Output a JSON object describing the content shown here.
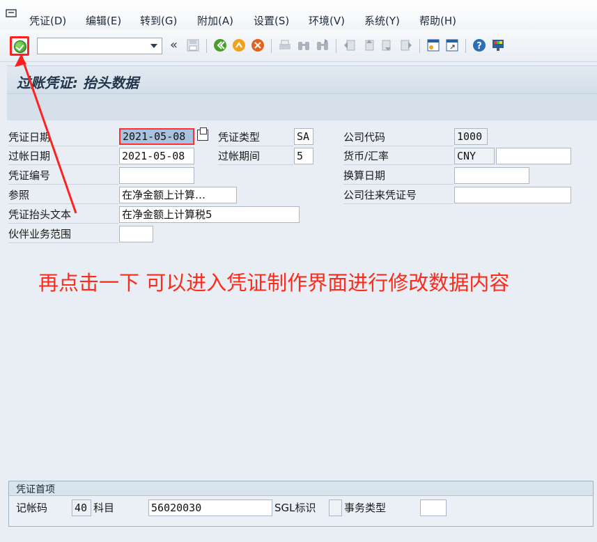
{
  "menu": {
    "items": [
      "凭证(D)",
      "编辑(E)",
      "转到(G)",
      "附加(A)",
      "设置(S)",
      "环境(V)",
      "系统(Y)",
      "帮助(H)"
    ]
  },
  "toolbar": {
    "command_value": "",
    "back_glyph": "«",
    "icons": [
      "enter-icon",
      "save-icon",
      "back-icon",
      "exit-icon",
      "cancel-icon",
      "print-icon",
      "find-icon",
      "find-next-icon",
      "first-page-icon",
      "prev-page-icon",
      "next-page-icon",
      "last-page-icon",
      "new-session-icon",
      "shortcut-icon",
      "help-icon",
      "customize-layout-icon"
    ]
  },
  "header": {
    "title": "过账凭证: 抬头数据"
  },
  "form": {
    "doc_date_label": "凭证日期",
    "doc_date_value": "2021-05-08",
    "doc_type_label": "凭证类型",
    "doc_type_value": "SA",
    "company_code_label": "公司代码",
    "company_code_value": "1000",
    "posting_date_label": "过帐日期",
    "posting_date_value": "2021-05-08",
    "period_label": "过帐期间",
    "period_value": "5",
    "currency_label": "货币/汇率",
    "currency_value": "CNY",
    "exchange_rate_value": "",
    "doc_number_label": "凭证编号",
    "doc_number_value": "",
    "translation_date_label": "换算日期",
    "translation_date_value": "",
    "reference_label": "参照",
    "reference_value": "在净金额上计算…",
    "intercompany_label": "公司往来凭证号",
    "intercompany_value": "",
    "header_text_label": "凭证抬头文本",
    "header_text_value": "在净金额上计算税5",
    "partner_area_label": "伙伴业务范围",
    "partner_area_value": ""
  },
  "annotation": {
    "text": "再点击一下 可以进入凭证制作界面进行修改数据内容",
    "color": "#ff2a1a"
  },
  "first_item": {
    "group_title": "凭证首项",
    "posting_key_label": "记帐码",
    "posting_key_value": "40",
    "account_label": "科目",
    "account_value": "56020030",
    "sgl_label": "SGL标识",
    "sgl_value": "",
    "transaction_type_label": "事务类型",
    "transaction_type_value": ""
  }
}
